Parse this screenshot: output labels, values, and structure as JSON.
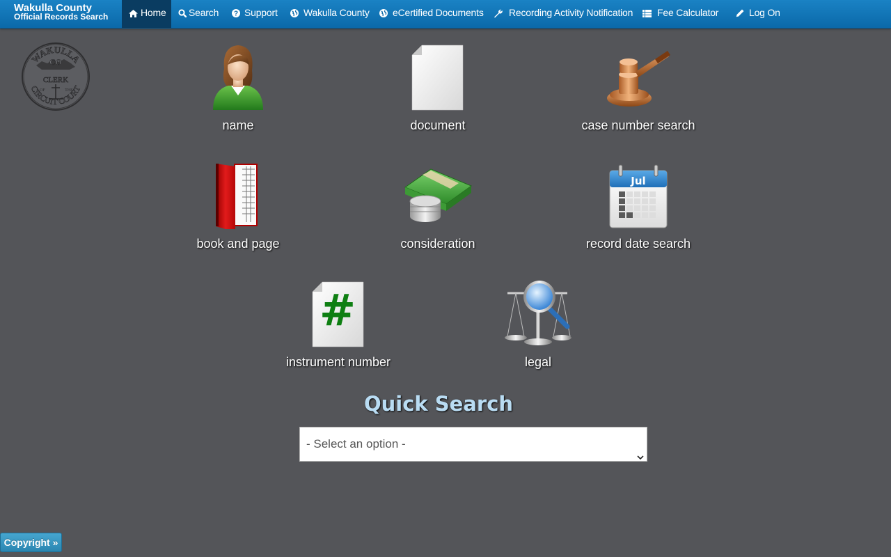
{
  "brand": {
    "line1": "Wakulla County",
    "line2": "Official Records Search"
  },
  "nav": [
    {
      "label": "Home",
      "icon": "home-icon",
      "active": true
    },
    {
      "label": "Search",
      "icon": "search-icon"
    },
    {
      "label": "Support",
      "icon": "question-circle-icon"
    },
    {
      "label": "Wakulla County",
      "icon": "globe-icon"
    },
    {
      "label": "eCertified Documents",
      "icon": "globe-icon"
    },
    {
      "label": "Recording Activity Notification",
      "icon": "wrench-icon"
    },
    {
      "label": "Fee Calculator",
      "icon": "list-icon"
    },
    {
      "label": "Log On",
      "icon": "pencil-icon"
    }
  ],
  "seal": {
    "top_text": "WAKULLA",
    "co": "CO",
    "clerk": "CLERK",
    "of": "OF",
    "the": "THE",
    "bottom_text": "CIRCUIT COURT"
  },
  "tiles": [
    {
      "label": "name",
      "icon": "person-icon"
    },
    {
      "label": "document",
      "icon": "document-icon"
    },
    {
      "label": "case number search",
      "icon": "gavel-icon"
    },
    {
      "label": "book and page",
      "icon": "book-icon"
    },
    {
      "label": "consideration",
      "icon": "money-icon"
    },
    {
      "label": "record date search",
      "icon": "calendar-icon",
      "calendar_month": "Jul"
    },
    {
      "label": "instrument number",
      "icon": "hash-document-icon",
      "glyph": "#"
    },
    {
      "label": "legal",
      "icon": "scales-magnifier-icon"
    }
  ],
  "quick_search": {
    "title": "Quick Search",
    "selected": "- Select an option -"
  },
  "footer": {
    "copyright_label": "Copyright »"
  },
  "colors": {
    "nav_bg": "#0b69a9",
    "nav_active": "#0a3c61",
    "page_bg": "#545559",
    "quick_search_title": "#b9dcf3",
    "copyright_button": "#2a86b1"
  }
}
